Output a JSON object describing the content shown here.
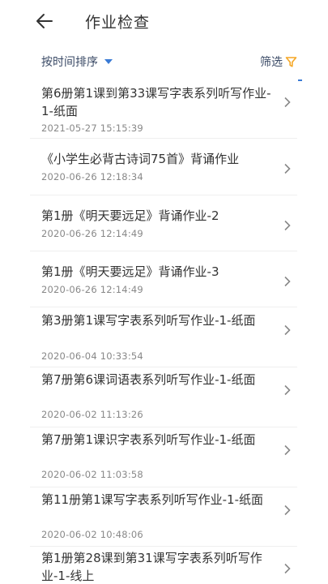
{
  "header": {
    "title": "作业检查",
    "back_icon": "arrow-left-icon"
  },
  "toolbar": {
    "sort_label": "按时间排序",
    "filter_label": "筛选",
    "accent_color": "#3a7bd5",
    "filter_color": "#f5a623"
  },
  "items": [
    {
      "name": "第6册第1课到第33课写字表系列听写作业-1-纸面",
      "time": "2021-05-27 15:15:39"
    },
    {
      "name": "《小学生必背古诗词75首》背诵作业",
      "time": "2020-06-26 12:18:34"
    },
    {
      "name": "第1册《明天要远足》背诵作业-2",
      "time": "2020-06-26 12:14:49"
    },
    {
      "name": "第1册《明天要远足》背诵作业-3",
      "time": "2020-06-26 12:14:49"
    },
    {
      "name": "第3册第1课写字表系列听写作业-1-纸面",
      "time": "2020-06-04 10:33:54"
    },
    {
      "name": "第7册第6课词语表系列听写作业-1-纸面",
      "time": "2020-06-02 11:13:26"
    },
    {
      "name": "第7册第1课识字表系列听写作业-1-纸面",
      "time": "2020-06-02 11:03:58"
    },
    {
      "name": "第11册第1课写字表系列听写作业-1-纸面",
      "time": "2020-06-02 10:48:06"
    },
    {
      "name": "第1册第28课到第31课写字表系列听写作业-1-线上",
      "time": ""
    }
  ]
}
